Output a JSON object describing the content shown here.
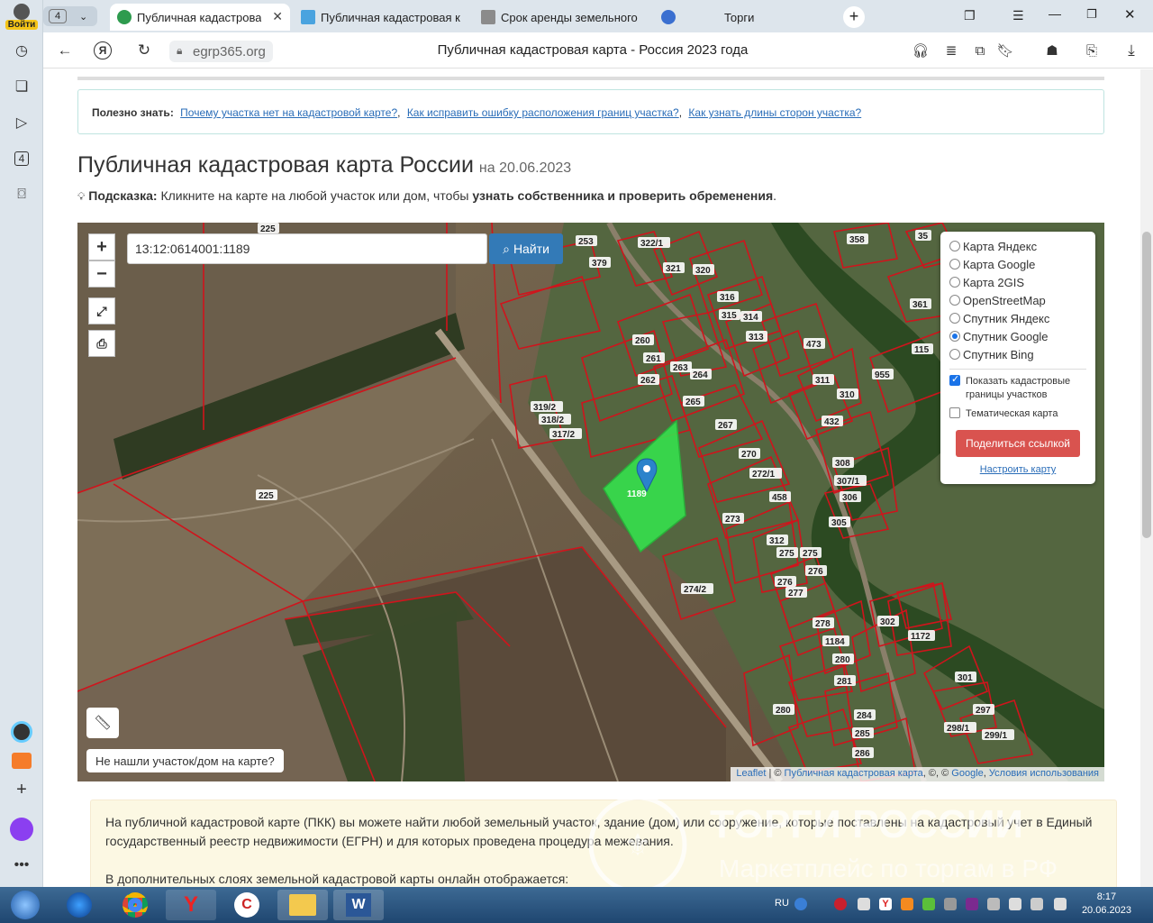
{
  "browser": {
    "tab_count": "4",
    "login_label": "Войти",
    "tabs": [
      {
        "title": "Публичная кадастрова",
        "active": true
      },
      {
        "title": "Публичная кадастровая к"
      },
      {
        "title": "Срок аренды земельного"
      },
      {
        "title": "Торги"
      }
    ],
    "url": "egrp365.org",
    "page_title": "Публичная кадастровая карта - Россия 2023 года"
  },
  "rail": {
    "badge": "4"
  },
  "page": {
    "info_label": "Полезно знать:",
    "info_links": [
      "Почему участка нет на кадастровой карте?",
      "Как исправить ошибку расположения границ участка?",
      "Как узнать длины сторон участка?"
    ],
    "title": "Публичная кадастровая карта России",
    "title_date": "на 20.06.2023",
    "hint_label": "Подсказка:",
    "hint_text": "Кликните на карте на любой участок или дом, чтобы",
    "hint_bold": "узнать собственника и проверить обременения",
    "hint_end": "."
  },
  "map": {
    "search_value": "13:12:0614001:1189",
    "search_button": "Найти",
    "zoom_in": "+",
    "zoom_out": "−",
    "layers": [
      {
        "label": "Карта Яндекс",
        "selected": false
      },
      {
        "label": "Карта Google",
        "selected": false
      },
      {
        "label": "Карта 2GIS",
        "selected": false
      },
      {
        "label": "OpenStreetMap",
        "selected": false
      },
      {
        "label": "Спутник Яндекс",
        "selected": false
      },
      {
        "label": "Спутник Google",
        "selected": true
      },
      {
        "label": "Спутник Bing",
        "selected": false
      }
    ],
    "show_borders_label": "Показать кадастровые границы участков",
    "thematic_label": "Тематическая карта",
    "share_button": "Поделиться ссылкой",
    "configure_link": "Настроить карту",
    "not_found_button": "Не нашли участок/дом на карте?",
    "attribution": {
      "leaflet": "Leaflet",
      "sep": " | © ",
      "pkk": "Публичная кадастровая карта",
      "mid": ", ©, © ",
      "google": "Google",
      "terms": "Условия использования"
    },
    "selected_parcel": "1189",
    "parcel_labels": [
      "225",
      "253",
      "379",
      "322/1",
      "321",
      "320",
      "316",
      "315",
      "314",
      "313",
      "260",
      "261",
      "262",
      "263",
      "264",
      "265",
      "319/2",
      "318/2",
      "317/2",
      "267",
      "270",
      "272/1",
      "458",
      "273",
      "274/2",
      "275",
      "275",
      "276",
      "277",
      "276",
      "312",
      "473",
      "955",
      "311",
      "310",
      "432",
      "308",
      "307/1",
      "306",
      "305",
      "358",
      "35",
      "361",
      "115",
      "302",
      "1172",
      "278",
      "1184",
      "280",
      "281",
      "301",
      "280",
      "284",
      "285",
      "286",
      "297",
      "298/1",
      "299/1",
      "225"
    ]
  },
  "description": {
    "line1": "На публичной кадастровой карте (ПКК) вы можете найти любой земельный участок, здание (дом) или сооружение, которые поставлены на кадастровый учет в Единый",
    "line2": "государственный реестр недвижимости (ЕГРН) и для которых проведена процедура межевания.",
    "line3": "В дополнительных слоях земельной кадастровой карты онлайн отображается:"
  },
  "watermark": {
    "title": "ТОРГИ РОССИИ",
    "subtitle": "Маркетплейс по торгам в РФ"
  },
  "taskbar": {
    "lang": "RU",
    "time": "8:17",
    "date": "20.06.2023"
  }
}
